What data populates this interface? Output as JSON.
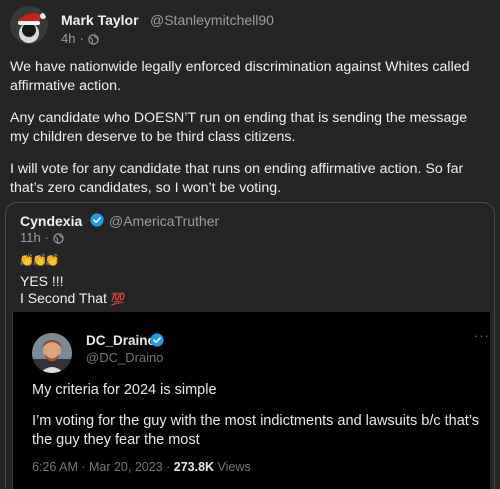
{
  "post": {
    "author_name": "Mark Taylor",
    "author_handle": "@Stanleymitchell90",
    "time": "4h",
    "meta_separator": "·",
    "paragraphs": [
      "We have nationwide legally enforced discrimination against Whites called affirmative action.",
      "Any candidate who DOESN’T run on ending that is sending the message my children deserve to be third class citizens.",
      "I will vote for any candidate that runs on ending affirmative action. So far that’s zero candidates, so I won’t be voting."
    ]
  },
  "quote": {
    "author_name": "Cyndexia",
    "author_handle": "@AmericaTruther",
    "time": "11h",
    "meta_separator": "·",
    "emoji_line": "👏👏👏",
    "line1": "YES !!!",
    "line2_text": "I Second That ",
    "line2_emoji": "💯"
  },
  "embedded": {
    "author_name": "DC_Draino",
    "author_handle": "@DC_Draino",
    "more_label": "···",
    "paragraph1": "My criteria for 2024 is simple",
    "paragraph2": "I’m voting for the guy with the most indictments and lawsuits b/c that’s the guy they fear the most",
    "timestamp": "6:26 AM · Mar 20, 2023 · ",
    "views_count": "273.8K",
    "views_label": " Views"
  },
  "colors": {
    "background": "#252526",
    "embedded_background": "#000000",
    "verified": "#1d9bf0",
    "secondary_text": "#9a9da1"
  }
}
